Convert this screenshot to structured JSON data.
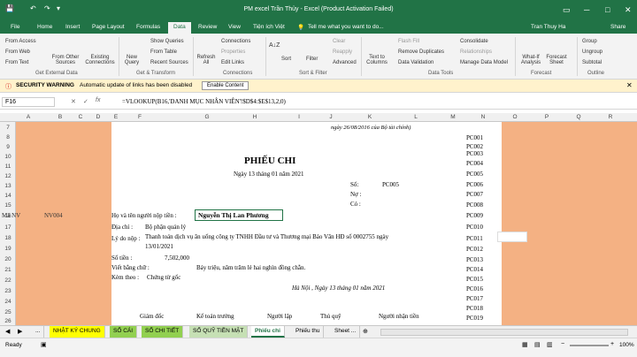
{
  "window": {
    "title": "PM excel Trần Thủy - Excel (Product Activation Failed)",
    "user": "Tran Thuy Ha"
  },
  "ribbon_tabs": [
    "File",
    "Home",
    "Insert",
    "Page Layout",
    "Formulas",
    "Data",
    "Review",
    "View",
    "Tiện ích Việt"
  ],
  "tellme": "Tell me what you want to do...",
  "share": "Share",
  "ribbon": {
    "from_access": "From Access",
    "from_web": "From Web",
    "from_text": "From Text",
    "from_other": "From Other Sources",
    "existing": "Existing Connections",
    "new_query": "New Query",
    "show_queries": "Show Queries",
    "from_table": "From Table",
    "recent_sources": "Recent Sources",
    "refresh_all": "Refresh All",
    "connections": "Connections",
    "properties": "Properties",
    "edit_links": "Edit Links",
    "sort": "Sort",
    "filter": "Filter",
    "clear": "Clear",
    "reapply": "Reapply",
    "advanced": "Advanced",
    "text_to_columns": "Text to Columns",
    "flash_fill": "Flash Fill",
    "remove_duplicates": "Remove Duplicates",
    "data_validation": "Data Validation",
    "consolidate": "Consolidate",
    "relationships": "Relationships",
    "manage_model": "Manage Data Model",
    "whatif": "What-If Analysis",
    "forecast": "Forecast Sheet",
    "group": "Group",
    "ungroup": "Ungroup",
    "subtotal": "Subtotal",
    "g_external": "Get External Data",
    "g_transform": "Get & Transform",
    "g_connections": "Connections",
    "g_sort": "Sort & Filter",
    "g_tools": "Data Tools",
    "g_forecast": "Forecast",
    "g_outline": "Outline"
  },
  "security": {
    "label": "SECURITY WARNING",
    "text": "Automatic update of links has been disabled",
    "button": "Enable Content"
  },
  "formula": {
    "cell": "F16",
    "content": "=VLOOKUP(B16,'DANH MỤC NHÂN VIÊN'!$D$4:$E$13,2,0)"
  },
  "columns": [
    "A",
    "B",
    "C",
    "D",
    "E",
    "F",
    "G",
    "H",
    "I",
    "J",
    "K",
    "L",
    "M",
    "N",
    "O",
    "P",
    "Q",
    "R"
  ],
  "rows": [
    "7",
    "8",
    "9",
    "10",
    "11",
    "12",
    "13",
    "14",
    "15",
    "16",
    "17",
    "18",
    "19",
    "20",
    "21",
    "22",
    "23",
    "24",
    "25",
    "26"
  ],
  "left_cells": {
    "a16": "Mã NV",
    "b16": "NV004"
  },
  "doc": {
    "top_note": "ngày 26/08/2016 của Bộ tài chính)",
    "title": "PHIẾU CHI",
    "date": "Ngày 13 tháng 01 năm 2021",
    "so_label": "Số:",
    "so_value": "PC005",
    "no_label": "Nợ :",
    "co_label": "Có :",
    "name_label": "Họ và tên người nộp tiền :",
    "name_value": "Nguyễn Thị Lan Phương",
    "address_label": "Địa chỉ :",
    "address_value": "Bộ phận quản lý",
    "reason_label": "Lý do nộp :",
    "reason_value1": "Thanh toán dịch vụ ăn uống công ty TNHH Đầu tư và Thương mại Bảo Văn HĐ số 0002755 ngày",
    "reason_value2": "13/01/2021",
    "amount_label": "Số tiền :",
    "amount_value": "7,502,000",
    "words_label": "Viết bằng chữ :",
    "words_value": "Bảy triệu, năm trăm lẻ hai nghìn đồng chẵn.",
    "attach_label": "Kèm theo :",
    "attach_value": "Chứng từ gốc",
    "place_date": "Hà Nội , Ngày 13 tháng 01 năm 2021",
    "sig": [
      "Giám đốc",
      "Kế toán trưởng",
      "Người lập",
      "Thủ quỹ",
      "Người nhận tiền"
    ]
  },
  "pc_list": [
    "PC001",
    "PC002",
    "PC003",
    "PC004",
    "PC005",
    "PC006",
    "PC007",
    "PC008",
    "PC009",
    "PC010",
    "PC011",
    "PC012",
    "PC013",
    "PC014",
    "PC015",
    "PC016",
    "PC017",
    "PC018",
    "PC019"
  ],
  "sheets": [
    "...",
    "NHẬT KÝ CHUNG",
    "SỔ CÁI",
    "SỔ CHI TIẾT",
    "SỔ QUỸ TIỀN MẶT",
    "Phiếu chi",
    "Phiếu thu",
    "Sheet ..."
  ],
  "status": {
    "ready": "Ready",
    "zoom": "100%"
  },
  "colors": {
    "excel_green": "#217346",
    "cell_fill": "#f4b183",
    "security_bg": "#fff2cc"
  }
}
